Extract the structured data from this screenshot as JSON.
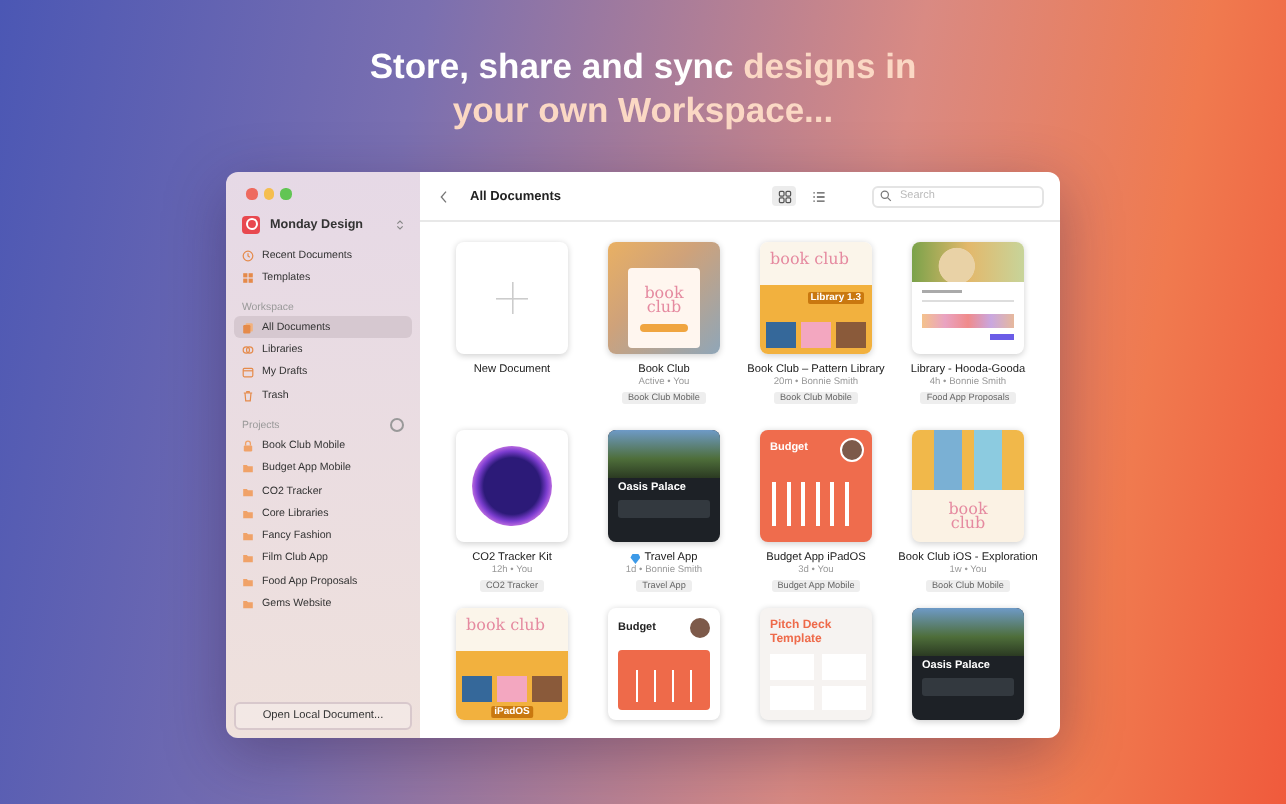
{
  "headline": [
    {
      "text": "Store, share and sync ",
      "accent": false
    },
    {
      "text": "designs in your own Workspace...",
      "accent": true
    }
  ],
  "sidebar": {
    "team": "Monday Design",
    "top_items": [
      {
        "label": "Recent Documents",
        "kind": "recent",
        "selected": false
      },
      {
        "label": "Templates",
        "kind": "templates",
        "selected": false
      }
    ],
    "workspace_label": "Workspace",
    "workspace_items": [
      {
        "label": "All Documents",
        "kind": "documents",
        "selected": true
      },
      {
        "label": "Libraries",
        "kind": "libraries",
        "selected": false
      },
      {
        "label": "My Drafts",
        "kind": "drafts",
        "selected": false
      },
      {
        "label": "Trash",
        "kind": "trash",
        "selected": false
      }
    ],
    "projects_label": "Projects",
    "projects": [
      {
        "label": "Book Club Mobile",
        "locked": true,
        "selected": false
      },
      {
        "label": "Budget App Mobile",
        "locked": false,
        "selected": false
      },
      {
        "label": "CO2 Tracker",
        "locked": false,
        "selected": false
      },
      {
        "label": "Core Libraries",
        "locked": false,
        "selected": false
      },
      {
        "label": "Fancy Fashion",
        "locked": false,
        "selected": false
      },
      {
        "label": "Film Club App",
        "locked": false,
        "selected": false
      },
      {
        "label": "Food App Proposals",
        "locked": false,
        "selected": false
      },
      {
        "label": "Gems Website",
        "locked": false,
        "selected": false
      }
    ],
    "open_local": "Open Local Document..."
  },
  "toolbar": {
    "title": "All Documents",
    "view_buttons": [
      {
        "kind": "grid",
        "selected": true
      },
      {
        "kind": "list",
        "selected": false
      }
    ],
    "search": {
      "placeholder": "Search"
    }
  },
  "documents": [
    {
      "title": "New Document",
      "thumb": {
        "kind": "new"
      }
    },
    {
      "title": "Book Club",
      "meta": "Active • You",
      "tag": "Book Club Mobile",
      "shared": false,
      "thumb": {
        "kind": "bookclub",
        "texts": [
          "book club"
        ]
      }
    },
    {
      "title": "Book Club – Pattern Library",
      "meta": "20m • Bonnie Smith",
      "tag": "Book Club Mobile",
      "shared": false,
      "thumb": {
        "kind": "library",
        "texts": [
          "book club",
          "Library 1.3"
        ]
      }
    },
    {
      "title": "Library - Hooda-Gooda",
      "meta": "4h • Bonnie Smith",
      "tag": "Food App Proposals",
      "shared": false,
      "thumb": {
        "kind": "food"
      }
    },
    {
      "title": "CO2 Tracker Kit",
      "meta": "12h • You",
      "tag": "CO2 Tracker",
      "shared": false,
      "thumb": {
        "kind": "blob"
      }
    },
    {
      "title": "Travel App",
      "meta": "1d • Bonnie Smith",
      "tag": "Travel App",
      "shared": true,
      "thumb": {
        "kind": "travel",
        "texts": [
          "Oasis Palace"
        ]
      }
    },
    {
      "title": "Budget App iPadOS",
      "meta": "3d • You",
      "tag": "Budget App Mobile",
      "shared": false,
      "thumb": {
        "kind": "budget",
        "texts": [
          "Budget"
        ]
      }
    },
    {
      "title": "Book Club iOS - Exploration",
      "meta": "1w • You",
      "tag": "Book Club Mobile",
      "shared": false,
      "thumb": {
        "kind": "bookclub2",
        "texts": [
          "book club"
        ]
      }
    },
    {
      "thumb": {
        "kind": "library",
        "texts": [
          "book club",
          "iPadOS"
        ]
      }
    },
    {
      "thumb": {
        "kind": "budget2",
        "texts": [
          "Budget"
        ]
      }
    },
    {
      "thumb": {
        "kind": "pitch",
        "texts": [
          "Pitch Deck Template"
        ]
      }
    },
    {
      "thumb": {
        "kind": "travel",
        "texts": [
          "Oasis Palace"
        ]
      }
    }
  ]
}
